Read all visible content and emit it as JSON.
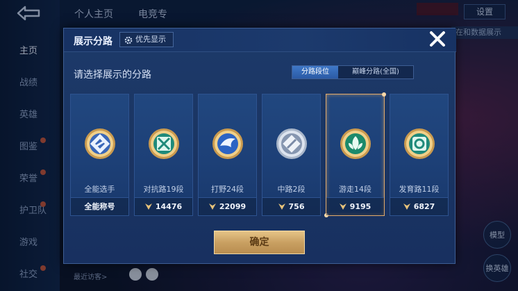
{
  "background": {
    "top_tabs": [
      "个人主页",
      "电竞专"
    ],
    "rail_items": [
      {
        "label": "主页",
        "active": true
      },
      {
        "label": "战绩",
        "active": false
      },
      {
        "label": "英雄",
        "active": false
      },
      {
        "label": "图鉴",
        "active": false
      },
      {
        "label": "荣誉",
        "active": false
      },
      {
        "label": "护卫队",
        "active": false
      },
      {
        "label": "游戏",
        "active": false
      },
      {
        "label": "社交",
        "active": false
      }
    ],
    "settings_label": "设置",
    "side_tag": "在和数据展示",
    "right_buttons": [
      "模型",
      "换英雄"
    ],
    "bottom_hint": "最近访客>"
  },
  "modal": {
    "title": "展示分路",
    "priority_label": "优先显示",
    "subtitle": "请选择展示的分路",
    "segments": [
      {
        "label": "分路段位",
        "active": true
      },
      {
        "label": "巅峰分路(全国)",
        "active": false
      }
    ],
    "cards": [
      {
        "label": "全能选手",
        "foot": "全能称号",
        "has_score": false,
        "selected": false,
        "emblem": "all-round-emblem-icon"
      },
      {
        "label": "对抗路19段",
        "foot": "14476",
        "has_score": true,
        "selected": false,
        "emblem": "clash-lane-emblem-icon"
      },
      {
        "label": "打野24段",
        "foot": "22099",
        "has_score": true,
        "selected": false,
        "emblem": "jungle-emblem-icon"
      },
      {
        "label": "中路2段",
        "foot": "756",
        "has_score": true,
        "selected": false,
        "emblem": "mid-lane-emblem-icon"
      },
      {
        "label": "游走14段",
        "foot": "9195",
        "has_score": true,
        "selected": true,
        "emblem": "roam-emblem-icon"
      },
      {
        "label": "发育路11段",
        "foot": "6827",
        "has_score": true,
        "selected": false,
        "emblem": "farm-lane-emblem-icon"
      }
    ],
    "confirm_label": "确定"
  },
  "colors": {
    "accent_gold": "#e0a96a",
    "modal_bg": "#1d3a6a",
    "segment_active": "#3f78c8"
  }
}
